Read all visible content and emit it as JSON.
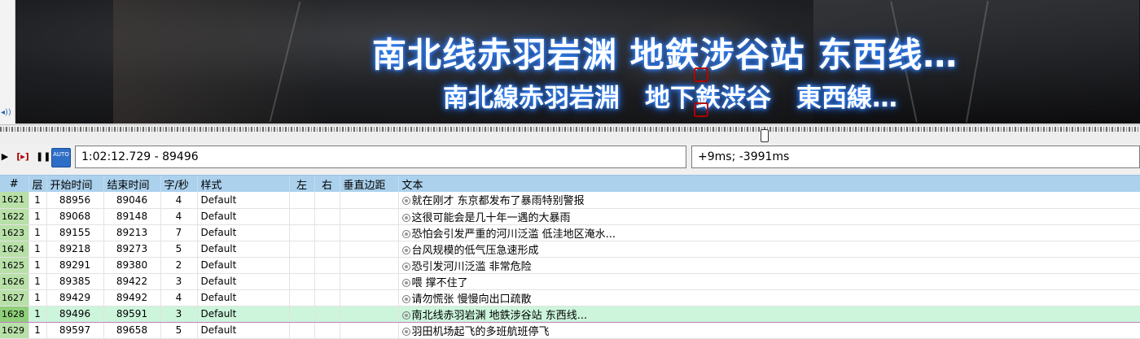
{
  "video": {
    "subtitle_line1": "南北线赤羽岩渊 地鉄涉谷站 东西线…",
    "subtitle_line2": "南北線赤羽岩淵　地下鉄渋谷　東西線…"
  },
  "controls": {
    "play_icon": "play-icon",
    "play_selection_icon": "play-selection-icon",
    "pause_icon": "pause-icon",
    "auto_scroll_label": "AUTO",
    "time_field": "1:02:12.729 - 89496",
    "offset_field": "+9ms; -3991ms"
  },
  "grid": {
    "headers": {
      "num": "#",
      "layer": "层",
      "start": "开始时间",
      "end": "结束时间",
      "cps": "字/秒",
      "style": "样式",
      "left": "左",
      "right": "右",
      "vmargin": "垂直边距",
      "text": "文本"
    },
    "rows": [
      {
        "num": "1621",
        "layer": "1",
        "start": "88956",
        "end": "89046",
        "cps": "4",
        "style": "Default",
        "text": "就在刚才 东京都发布了暴雨特别警报"
      },
      {
        "num": "1622",
        "layer": "1",
        "start": "89068",
        "end": "89148",
        "cps": "4",
        "style": "Default",
        "text": "这很可能会是几十年一遇的大暴雨"
      },
      {
        "num": "1623",
        "layer": "1",
        "start": "89155",
        "end": "89213",
        "cps": "7",
        "style": "Default",
        "text": "恐怕会引发严重的河川泛滥 低洼地区淹水..."
      },
      {
        "num": "1624",
        "layer": "1",
        "start": "89218",
        "end": "89273",
        "cps": "5",
        "style": "Default",
        "text": "台风规模的低气压急速形成"
      },
      {
        "num": "1625",
        "layer": "1",
        "start": "89291",
        "end": "89380",
        "cps": "2",
        "style": "Default",
        "text": "恐引发河川泛滥 非常危险"
      },
      {
        "num": "1626",
        "layer": "1",
        "start": "89385",
        "end": "89422",
        "cps": "3",
        "style": "Default",
        "text": "喂 撑不住了"
      },
      {
        "num": "1627",
        "layer": "1",
        "start": "89429",
        "end": "89492",
        "cps": "4",
        "style": "Default",
        "text": "请勿慌张 慢慢向出口疏散"
      },
      {
        "num": "1628",
        "layer": "1",
        "start": "89496",
        "end": "89591",
        "cps": "3",
        "style": "Default",
        "text": "南北线赤羽岩渊 地鉄涉谷站 东西线...",
        "active": true
      },
      {
        "num": "1629",
        "layer": "1",
        "start": "89597",
        "end": "89658",
        "cps": "5",
        "style": "Default",
        "text": "羽田机场起飞的多班航班停飞"
      }
    ]
  }
}
